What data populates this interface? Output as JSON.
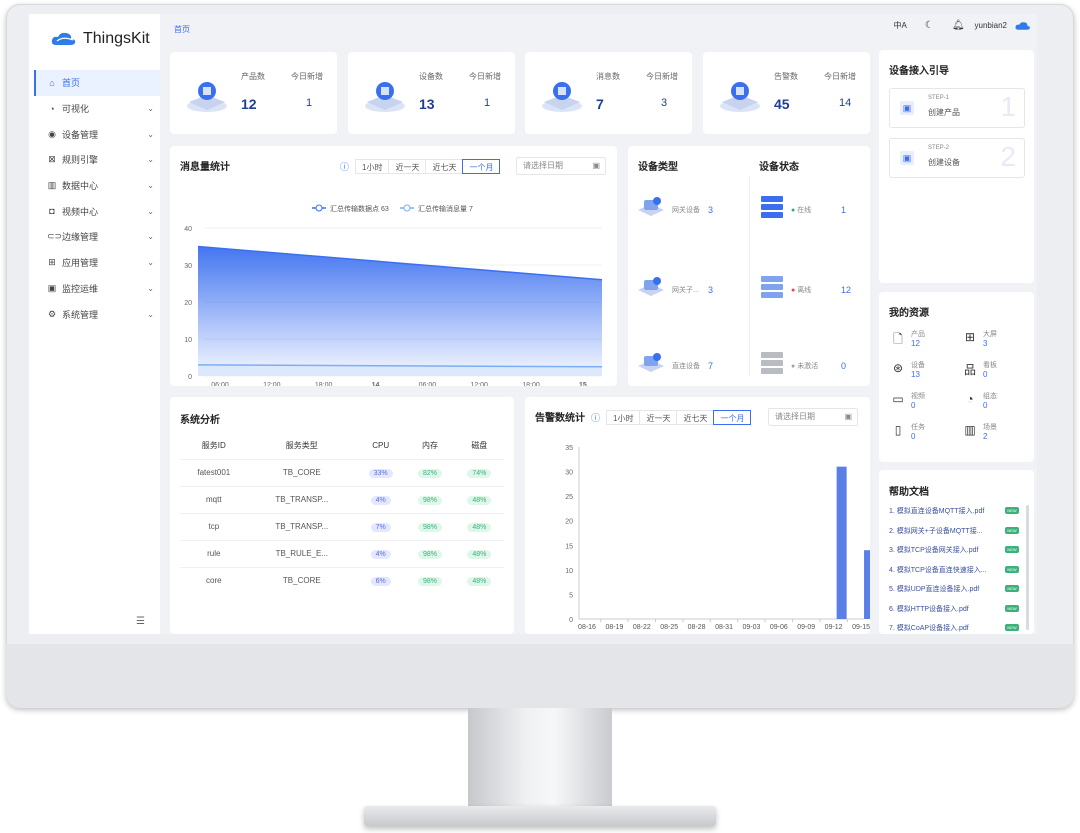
{
  "app": {
    "name": "ThingsKit",
    "breadcrumb": "首页",
    "username": "yunbian2"
  },
  "topbar": {
    "lang_icon": "中A",
    "theme_icon": "moon-icon",
    "bell_icon": "bell-icon"
  },
  "sidebar": {
    "items": [
      {
        "label": "首页",
        "icon": "⌂",
        "active": true
      },
      {
        "label": "可视化",
        "icon": "◔"
      },
      {
        "label": "设备管理",
        "icon": "◉"
      },
      {
        "label": "规则引擎",
        "icon": "⊠"
      },
      {
        "label": "数据中心",
        "icon": "▥"
      },
      {
        "label": "视频中心",
        "icon": "◘"
      },
      {
        "label": "边缘管理",
        "icon": "⊂⊃"
      },
      {
        "label": "应用管理",
        "icon": "⊞"
      },
      {
        "label": "监控运维",
        "icon": "▣"
      },
      {
        "label": "系统管理",
        "icon": "⚙"
      }
    ],
    "collapse_icon": "☰"
  },
  "stats": [
    {
      "label": "产品数",
      "value": "12",
      "today_label": "今日新增",
      "today": "1"
    },
    {
      "label": "设备数",
      "value": "13",
      "today_label": "今日新增",
      "today": "1"
    },
    {
      "label": "消息数",
      "value": "7",
      "today_label": "今日新增",
      "today": "3"
    },
    {
      "label": "告警数",
      "value": "45",
      "today_label": "今日新增",
      "today": "14"
    }
  ],
  "messages": {
    "title": "消息量统计",
    "ranges": [
      "1小时",
      "近一天",
      "近七天",
      "一个月"
    ],
    "date_placeholder": "请选择日期",
    "legend": [
      "汇总传输数据点 63",
      "汇总传输消息量 7"
    ]
  },
  "devices": {
    "type_title": "设备类型",
    "status_title": "设备状态",
    "types": [
      {
        "label": "网关设备",
        "value": "3"
      },
      {
        "label": "网关子...",
        "value": "3"
      },
      {
        "label": "直连设备",
        "value": "7"
      }
    ],
    "statuses": [
      {
        "label": "在线",
        "value": "1",
        "color": "#2fb56a"
      },
      {
        "label": "离线",
        "value": "12",
        "color": "#e5484d"
      },
      {
        "label": "未激活",
        "value": "0",
        "color": "#9aa0a6"
      }
    ]
  },
  "system": {
    "title": "系统分析",
    "headers": [
      "服务ID",
      "服务类型",
      "CPU",
      "内存",
      "磁盘"
    ],
    "rows": [
      [
        "fatest001",
        "TB_CORE",
        "33%",
        "82%",
        "74%"
      ],
      [
        "mqtt",
        "TB_TRANSP...",
        "4%",
        "98%",
        "48%"
      ],
      [
        "tcp",
        "TB_TRANSP...",
        "7%",
        "98%",
        "48%"
      ],
      [
        "rule",
        "TB_RULE_E...",
        "4%",
        "98%",
        "48%"
      ],
      [
        "core",
        "TB_CORE",
        "6%",
        "98%",
        "48%"
      ]
    ]
  },
  "alarms": {
    "title": "告警数统计",
    "ranges": [
      "1小时",
      "近一天",
      "近七天",
      "一个月"
    ],
    "date_placeholder": "请选择日期"
  },
  "guide": {
    "title": "设备接入引导",
    "steps": [
      {
        "step": "STEP-1",
        "label": "创建产品",
        "num": "1"
      },
      {
        "step": "STEP-2",
        "label": "创建设备",
        "num": "2"
      }
    ]
  },
  "resources": {
    "title": "我的资源",
    "items": [
      {
        "label": "产品",
        "value": "12",
        "icon": "🗋"
      },
      {
        "label": "大屏",
        "value": "3",
        "icon": "⊞"
      },
      {
        "label": "设备",
        "value": "13",
        "icon": "⊛"
      },
      {
        "label": "看板",
        "value": "0",
        "icon": "品"
      },
      {
        "label": "视频",
        "value": "0",
        "icon": "▭"
      },
      {
        "label": "组态",
        "value": "0",
        "icon": "◔"
      },
      {
        "label": "任务",
        "value": "0",
        "icon": "▯"
      },
      {
        "label": "场景",
        "value": "2",
        "icon": "▥"
      }
    ]
  },
  "help": {
    "title": "帮助文档",
    "new_label": "NEW",
    "docs": [
      "1. 模拟直连设备MQTT接入.pdf",
      "2. 模拟网关+子设备MQTT接...",
      "3. 模拟TCP设备网关接入.pdf",
      "4. 模拟TCP设备直连快速接入...",
      "5. 模拟UDP直连设备接入.pdf",
      "6. 模拟HTTP设备接入.pdf",
      "7. 模拟CoAP设备接入.pdf"
    ]
  },
  "chart_data": [
    {
      "type": "area",
      "title": "消息量统计",
      "x_ticks": [
        "06:00",
        "12:00",
        "18:00",
        "14",
        "06:00",
        "12:00",
        "18:00",
        "15"
      ],
      "ylim": [
        0,
        40
      ],
      "y_ticks": [
        0,
        10,
        20,
        30,
        40
      ],
      "series": [
        {
          "name": "汇总传输数据点 63",
          "x": [
            0,
            1
          ],
          "values": [
            35,
            26
          ],
          "color": "#3a6ff0"
        },
        {
          "name": "汇总传输消息量 7",
          "x": [
            0,
            1
          ],
          "values": [
            3,
            2.5
          ],
          "color": "#7aaef7"
        }
      ]
    },
    {
      "type": "bar",
      "title": "告警数统计",
      "categories": [
        "08-16",
        "08-19",
        "08-22",
        "08-25",
        "08-28",
        "08-31",
        "09-03",
        "09-06",
        "09-09",
        "09-12",
        "09-15"
      ],
      "values": [
        0,
        0,
        0,
        0,
        0,
        0,
        0,
        0,
        0,
        31,
        14
      ],
      "ylim": [
        0,
        35
      ],
      "y_ticks": [
        0,
        5,
        10,
        15,
        20,
        25,
        30,
        35
      ],
      "color": "#5b7fe6"
    }
  ]
}
